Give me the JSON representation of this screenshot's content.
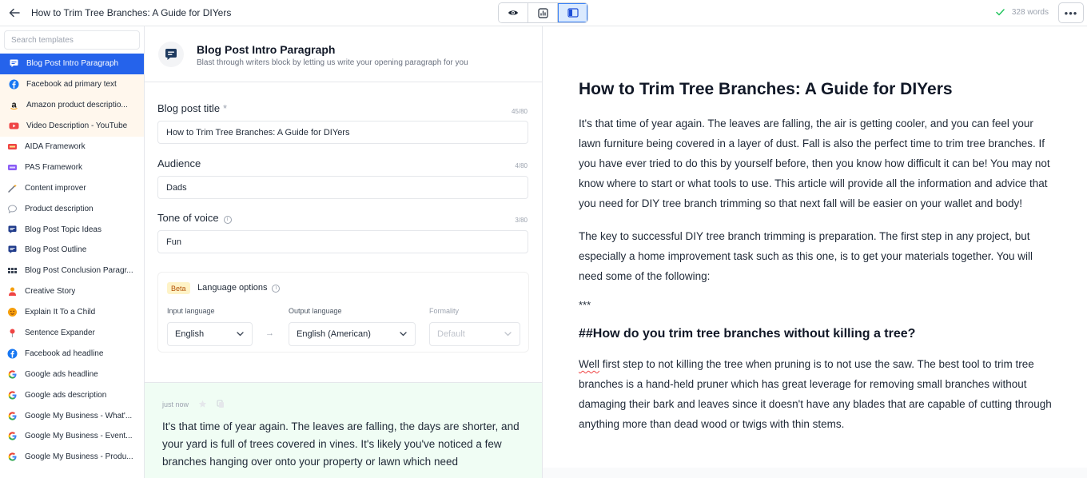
{
  "topbar": {
    "title": "How to Trim Tree Branches: A Guide for DIYers",
    "word_count": "328 words",
    "views": [
      {
        "icon": "eye-icon",
        "active": false
      },
      {
        "icon": "bar-chart-icon",
        "active": false
      },
      {
        "icon": "split-layout-icon",
        "active": true
      }
    ]
  },
  "sidebar": {
    "search_placeholder": "Search templates",
    "templates": [
      {
        "label": "Blog Post Intro Paragraph",
        "icon": "chat-bubble-icon",
        "color": "#ffffff",
        "state": "active"
      },
      {
        "label": "Facebook ad primary text",
        "icon": "facebook-icon",
        "color": "#1877f2",
        "state": "pinned"
      },
      {
        "label": "Amazon product descriptio...",
        "icon": "amazon-icon",
        "color": "#111111",
        "state": "pinned"
      },
      {
        "label": "Video Description - YouTube",
        "icon": "youtube-icon",
        "color": "#ef4444",
        "state": "pinned"
      },
      {
        "label": "AIDA Framework",
        "icon": "aida-icon",
        "color": "#ef4444",
        "state": "normal"
      },
      {
        "label": "PAS Framework",
        "icon": "pas-icon",
        "color": "#8b5cf6",
        "state": "normal"
      },
      {
        "label": "Content improver",
        "icon": "magic-wand-icon",
        "color": "#6b7280",
        "state": "normal"
      },
      {
        "label": "Product description",
        "icon": "speech-bubble-icon",
        "color": "#9ca3af",
        "state": "normal"
      },
      {
        "label": "Blog Post Topic Ideas",
        "icon": "chat-bubble-icon",
        "color": "#1e3a8a",
        "state": "normal"
      },
      {
        "label": "Blog Post Outline",
        "icon": "chat-bubble-icon",
        "color": "#1e3a8a",
        "state": "normal"
      },
      {
        "label": "Blog Post Conclusion Paragr...",
        "icon": "grid-icon",
        "color": "#374151",
        "state": "normal"
      },
      {
        "label": "Creative Story",
        "icon": "person-icon",
        "color": "#f59e0b",
        "state": "normal"
      },
      {
        "label": "Explain It To a Child",
        "icon": "child-icon",
        "color": "#f59e0b",
        "state": "normal"
      },
      {
        "label": "Sentence Expander",
        "icon": "pin-icon",
        "color": "#ef4444",
        "state": "normal"
      },
      {
        "label": "Facebook ad headline",
        "icon": "facebook-icon",
        "color": "#1877f2",
        "state": "normal"
      },
      {
        "label": "Google ads headline",
        "icon": "google-icon",
        "color": "#4285f4",
        "state": "normal"
      },
      {
        "label": "Google ads description",
        "icon": "google-icon",
        "color": "#4285f4",
        "state": "normal"
      },
      {
        "label": "Google My Business - What'...",
        "icon": "google-icon",
        "color": "#4285f4",
        "state": "normal"
      },
      {
        "label": "Google My Business - Event...",
        "icon": "google-icon",
        "color": "#4285f4",
        "state": "normal"
      },
      {
        "label": "Google My Business - Produ...",
        "icon": "google-icon",
        "color": "#4285f4",
        "state": "normal"
      }
    ]
  },
  "form": {
    "header": {
      "title": "Blog Post Intro Paragraph",
      "description": "Blast through writers block by letting us write your opening paragraph for you"
    },
    "blog_title": {
      "label": "Blog post title",
      "required": "*",
      "counter": "45/80",
      "value": "How to Trim Tree Branches: A Guide for DIYers"
    },
    "audience": {
      "label": "Audience",
      "counter": "4/80",
      "value": "Dads"
    },
    "tone": {
      "label": "Tone of voice",
      "counter": "3/80",
      "value": "Fun"
    },
    "language": {
      "badge": "Beta",
      "title": "Language options",
      "input_label": "Input language",
      "input_value": "English",
      "output_label": "Output language",
      "output_value": "English (American)",
      "formality_label": "Formality",
      "formality_value": "Default",
      "arrow": "→"
    },
    "output": {
      "time": "just now",
      "text": "It's that time of year again. The leaves are falling, the days are shorter, and your yard is full of trees covered in vines. It's likely you've noticed a few branches hanging over onto your property or lawn which need"
    }
  },
  "editor": {
    "heading": "How to Trim Tree Branches: A Guide for DIYers",
    "p1": "It's that time of year again. The leaves are falling, the air is getting cooler, and you can feel your lawn furniture being covered in a layer of dust. Fall is also the perfect time to trim tree branches. If you have ever tried to do this by yourself before, then you know how difficult it can be! You may not know where to start or what tools to use. This article will provide all the information and advice that you need for DIY tree branch trimming so that next fall will be easier on your wallet and body!",
    "p2": "The key to successful DIY tree branch trimming is preparation. The first step in any project, but especially a home improvement task such as this one, is to get your materials together. You will need some of the following:",
    "separator": "***",
    "subheading": "##How do you trim tree branches without killing a tree?",
    "p3_first_word": "Well",
    "p3_rest": " first step to not killing the tree when pruning is to not use the saw. The best tool to trim tree branches is a hand-held pruner which has great leverage for removing small branches without damaging their bark and leaves since it doesn't have any blades that are capable of cutting through anything more than dead wood or twigs with thin stems."
  }
}
